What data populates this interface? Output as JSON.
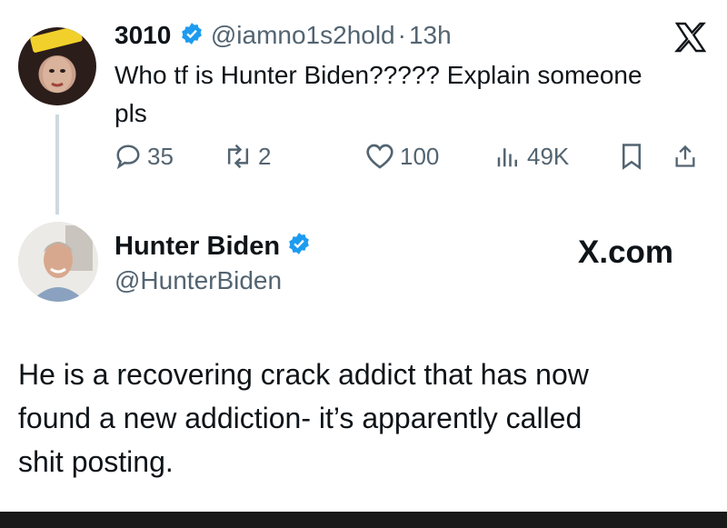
{
  "tweet": {
    "author_name": "3010",
    "handle": "@iamno1s2hold",
    "separator": "·",
    "time": "13h",
    "text_line1": "Who tf is Hunter Biden????? Explain someone",
    "text_line2": "pls",
    "stats": {
      "replies": "35",
      "retweets": "2",
      "likes": "100",
      "views": "49K"
    }
  },
  "reply": {
    "author_name": "Hunter Biden",
    "handle": "@HunterBiden",
    "source": "X.com",
    "text_line1": "He is a recovering crack addict that has now",
    "text_line2": "found a new addiction- it’s apparently called",
    "text_line3": "shit posting."
  },
  "colors": {
    "verified": "#1d9bf0",
    "muted": "#536471",
    "text": "#0f1419",
    "thread_line": "#cfd9de"
  },
  "icons": [
    "verified-badge-icon",
    "x-logo-icon",
    "reply-icon",
    "retweet-icon",
    "like-icon",
    "views-icon",
    "bookmark-icon",
    "share-icon"
  ]
}
